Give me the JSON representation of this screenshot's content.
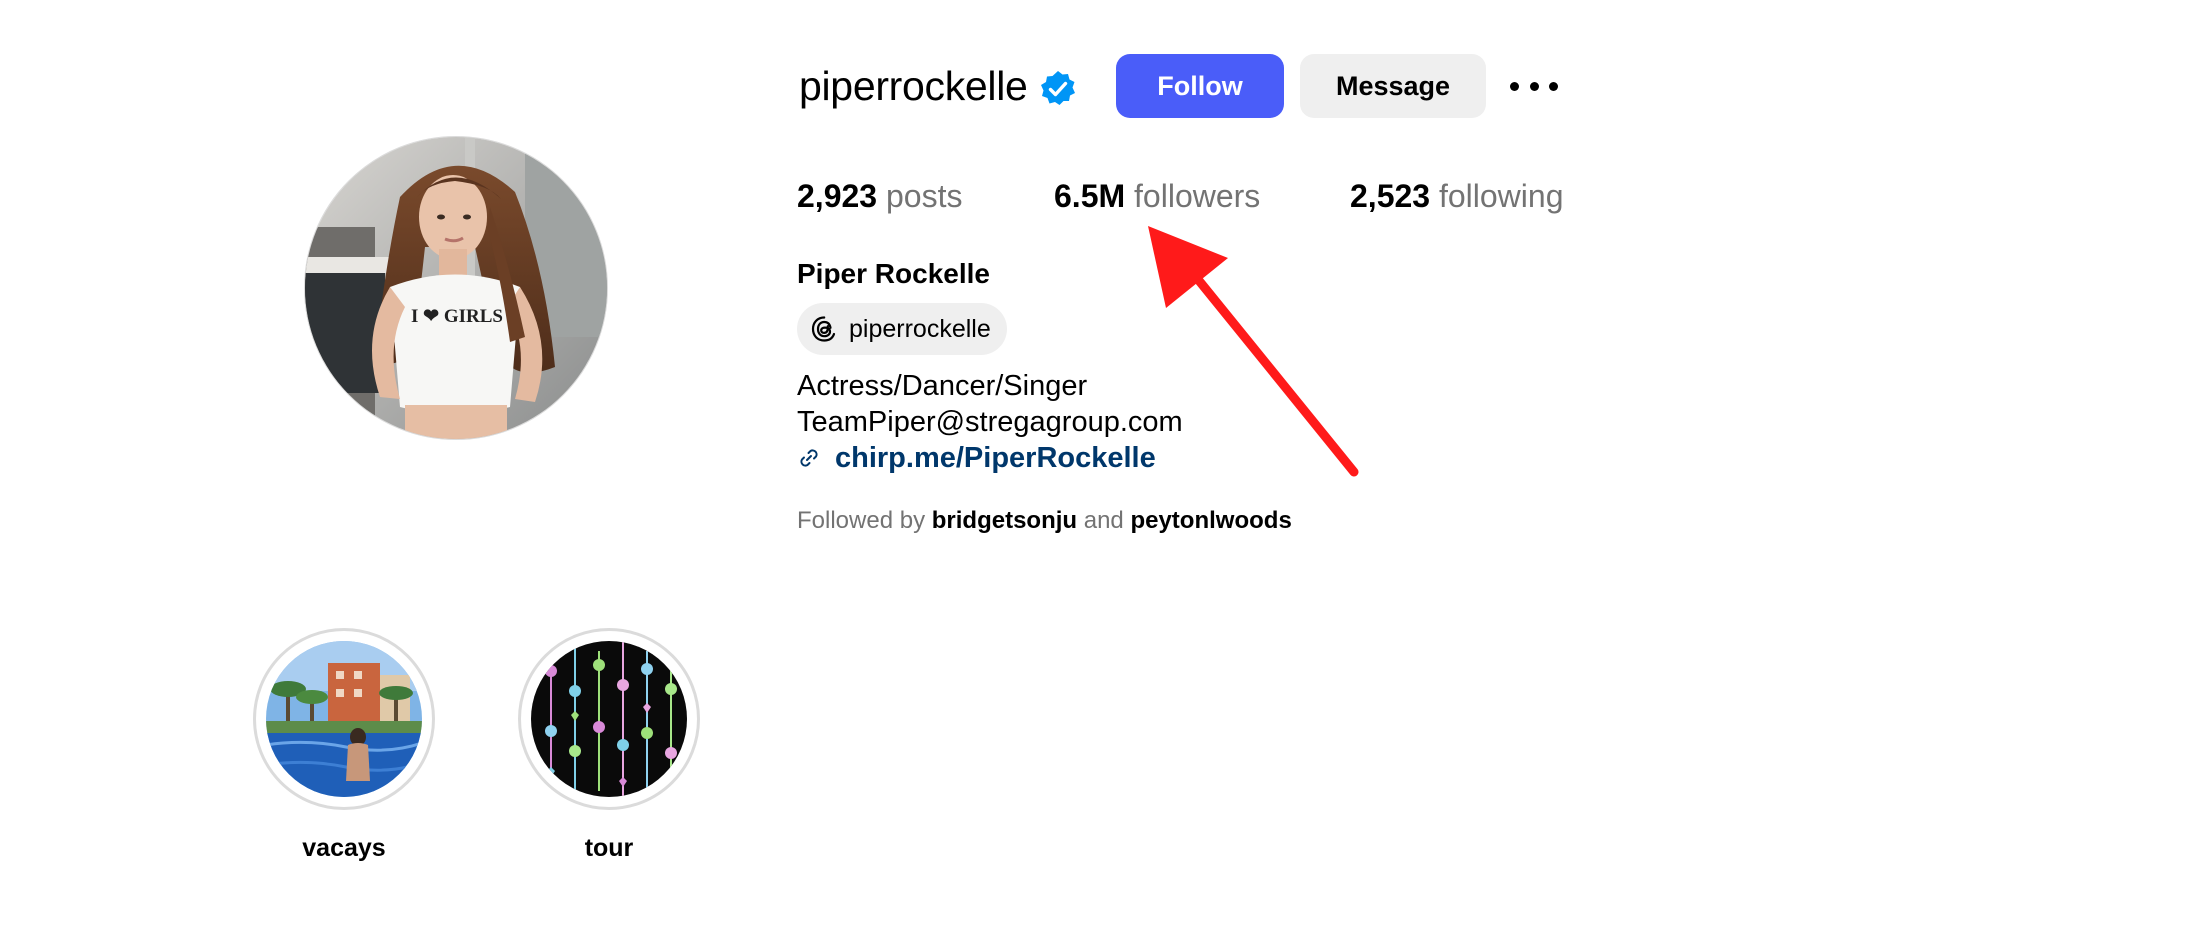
{
  "profile": {
    "username": "piperrockelle",
    "verified": true,
    "full_name": "Piper Rockelle",
    "threads_handle": "piperrockelle",
    "bio_lines": [
      "Actress/Dancer/Singer",
      "TeamPiper@stregagroup.com"
    ],
    "link": "chirp.me/PiperRockelle",
    "shirt_text": "I ❤ GIRLS"
  },
  "actions": {
    "follow_label": "Follow",
    "message_label": "Message"
  },
  "stats": {
    "posts": {
      "value": "2,923",
      "label": "posts"
    },
    "followers": {
      "value": "6.5M",
      "label": "followers"
    },
    "following": {
      "value": "2,523",
      "label": "following"
    }
  },
  "followed_by": {
    "prefix": "Followed by",
    "user1": "bridgetsonju",
    "joiner": "and",
    "user2": "peytonlwoods"
  },
  "highlights": [
    {
      "label": "vacays"
    },
    {
      "label": "tour"
    }
  ],
  "icons": {
    "verified": "verified-badge-icon",
    "threads": "threads-icon",
    "link": "link-icon",
    "more": "more-options-icon"
  },
  "colors": {
    "follow_button": "#4a5df9",
    "message_button": "#efefef",
    "verified_badge": "#0095f6",
    "link": "#00376b",
    "muted_text": "#737373",
    "annotation_arrow": "#ff1a1a"
  }
}
